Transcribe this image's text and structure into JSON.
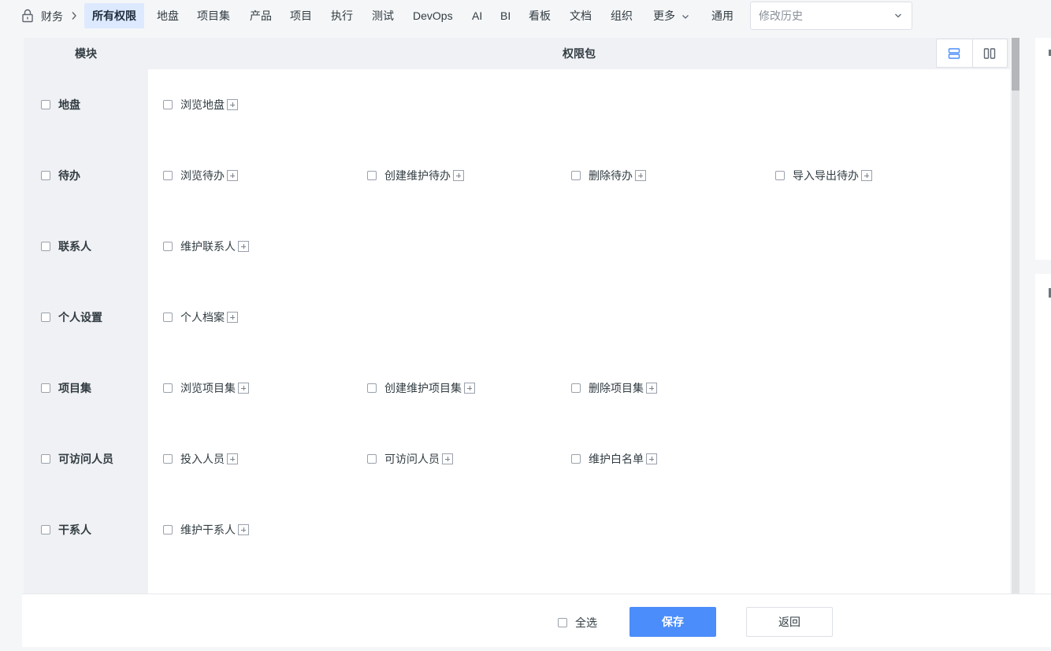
{
  "breadcrumb": {
    "current": "财务"
  },
  "nav": {
    "active": "所有权限",
    "items": [
      "地盘",
      "项目集",
      "产品",
      "项目",
      "执行",
      "测试",
      "DevOps",
      "AI",
      "BI",
      "看板",
      "文档",
      "组织",
      "更多"
    ],
    "general": "通用"
  },
  "history": {
    "placeholder": "修改历史"
  },
  "table": {
    "header_module": "模块",
    "header_perm": "权限包",
    "rows": [
      {
        "module": "地盘",
        "perms": [
          "浏览地盘"
        ]
      },
      {
        "module": "待办",
        "perms": [
          "浏览待办",
          "创建维护待办",
          "删除待办",
          "导入导出待办"
        ]
      },
      {
        "module": "联系人",
        "perms": [
          "维护联系人"
        ]
      },
      {
        "module": "个人设置",
        "perms": [
          "个人档案"
        ]
      },
      {
        "module": "项目集",
        "perms": [
          "浏览项目集",
          "创建维护项目集",
          "删除项目集"
        ]
      },
      {
        "module": "可访问人员",
        "perms": [
          "投入人员",
          "可访问人员",
          "维护白名单"
        ]
      },
      {
        "module": "干系人",
        "perms": [
          "维护干系人"
        ]
      }
    ]
  },
  "footer": {
    "select_all": "全选",
    "save": "保存",
    "back": "返回"
  },
  "colors": {
    "primary": "#4b8dfa",
    "active_tab_bg": "#dde9ff",
    "table_header_bg": "#f0f1f4"
  }
}
